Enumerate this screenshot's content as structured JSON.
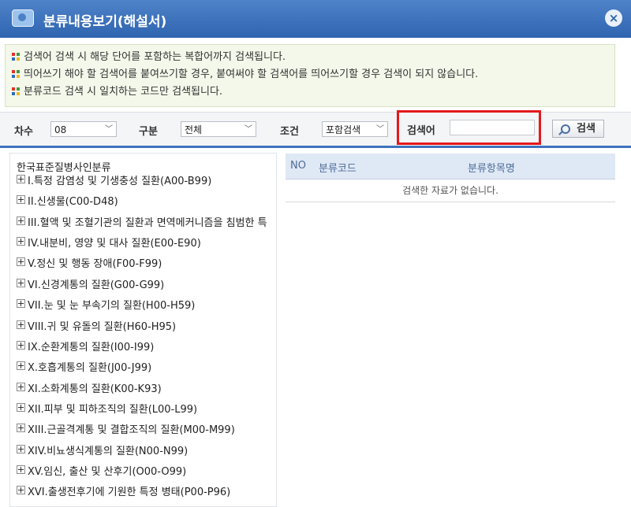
{
  "window": {
    "title": "분류내용보기(해설서)",
    "close_label": "×"
  },
  "notices": [
    "검색어 검색 시 해당 단어를 포함하는 복합어까지 검색됩니다.",
    "띄어쓰기 해야 할 검색어를 붙여쓰기할 경우, 붙여써야 할 검색어를 띄어쓰기할 경우 검색이 되지 않습니다.",
    "분류코드 검색 시 일치하는 코드만 검색됩니다."
  ],
  "filters": {
    "revision_label": "차수",
    "revision_value": "08",
    "type_label": "구분",
    "type_value": "전체",
    "condition_label": "조건",
    "condition_value": "포함검색",
    "keyword_label": "검색어",
    "keyword_value": "",
    "search_button": "검색"
  },
  "tree": {
    "root": "한국표준질병사인분류",
    "items": [
      "I.특정 감염성 및 기생충성 질환(A00-B99)",
      "II.신생물(C00-D48)",
      "III.혈액 및 조혈기관의 질환과 면역메커니즘을 침범한 특",
      "IV.내분비, 영양 및 대사 질환(E00-E90)",
      "V.정신 및 행동 장애(F00-F99)",
      "VI.신경계통의 질환(G00-G99)",
      "VII.눈 및 눈 부속기의 질환(H00-H59)",
      "VIII.귀 및 유돌의 질환(H60-H95)",
      "IX.순환계통의 질환(I00-I99)",
      "X.호흡계통의 질환(J00-J99)",
      "XI.소화계통의 질환(K00-K93)",
      "XII.피부 및 피하조직의 질환(L00-L99)",
      "XIII.근골격계통 및 결합조직의 질환(M00-M99)",
      "XIV.비뇨생식계통의 질환(N00-N99)",
      "XV.임신, 출산 및 산후기(O00-O99)",
      "XVI.출생전후기에 기원한 특정 병태(P00-P96)"
    ]
  },
  "results": {
    "columns": [
      "NO",
      "분류코드",
      "분류항목명"
    ],
    "empty_message": "검색한 자료가 없습니다."
  }
}
